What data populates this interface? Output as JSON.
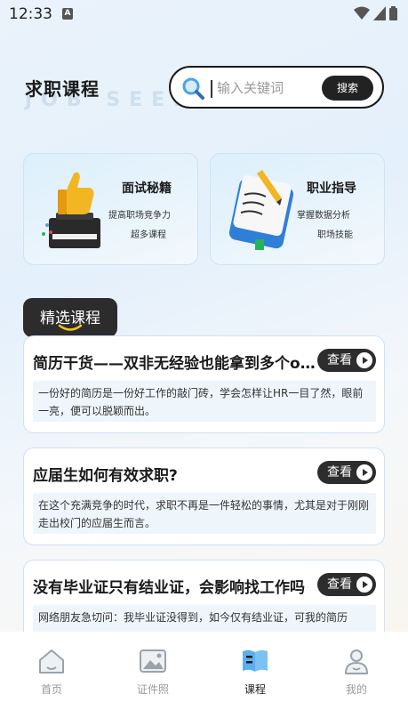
{
  "status": {
    "time": "12:33"
  },
  "header": {
    "title": "求职课程",
    "watermark": "JOB SEEKER",
    "search_placeholder": "输入关键词",
    "search_button": "搜索"
  },
  "features": [
    {
      "title": "面试秘籍",
      "sub1": "提高职场竞争力",
      "sub2": "超多课程"
    },
    {
      "title": "职业指导",
      "sub1": "掌握数据分析",
      "sub2": "职场技能"
    }
  ],
  "section": {
    "title": "精选课程"
  },
  "courses": [
    {
      "title": "简历干货——双非无经验也能拿到多个offer",
      "view": "查看",
      "desc": "一份好的简历是一份好工作的敲门砖，学会怎样让HR一目了然，眼前一亮，便可以脱颖而出。"
    },
    {
      "title": "应届生如何有效求职?",
      "view": "查看",
      "desc": "在这个充满竞争的时代，求职不再是一件轻松的事情，尤其是对于刚刚走出校门的应届生而言。"
    },
    {
      "title": "没有毕业证只有结业证，会影响找工作吗",
      "view": "查看",
      "desc": "网络朋友急切问：我毕业证没得到，如今仅有结业证，可我的简历"
    }
  ],
  "nav": [
    {
      "label": "首页",
      "icon": "home-icon"
    },
    {
      "label": "证件照",
      "icon": "image-icon"
    },
    {
      "label": "课程",
      "icon": "book-icon",
      "active": true
    },
    {
      "label": "我的",
      "icon": "user-icon"
    }
  ],
  "colors": {
    "accent": "#4aa3e8",
    "dark": "#222222"
  }
}
